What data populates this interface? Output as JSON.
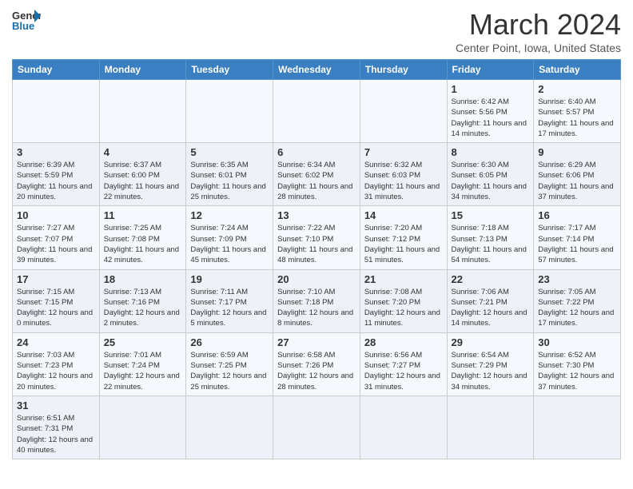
{
  "logo": {
    "line1": "General",
    "line2": "Blue"
  },
  "title": "March 2024",
  "subtitle": "Center Point, Iowa, United States",
  "days_of_week": [
    "Sunday",
    "Monday",
    "Tuesday",
    "Wednesday",
    "Thursday",
    "Friday",
    "Saturday"
  ],
  "weeks": [
    [
      {
        "day": "",
        "info": ""
      },
      {
        "day": "",
        "info": ""
      },
      {
        "day": "",
        "info": ""
      },
      {
        "day": "",
        "info": ""
      },
      {
        "day": "",
        "info": ""
      },
      {
        "day": "1",
        "info": "Sunrise: 6:42 AM\nSunset: 5:56 PM\nDaylight: 11 hours and 14 minutes."
      },
      {
        "day": "2",
        "info": "Sunrise: 6:40 AM\nSunset: 5:57 PM\nDaylight: 11 hours and 17 minutes."
      }
    ],
    [
      {
        "day": "3",
        "info": "Sunrise: 6:39 AM\nSunset: 5:59 PM\nDaylight: 11 hours and 20 minutes."
      },
      {
        "day": "4",
        "info": "Sunrise: 6:37 AM\nSunset: 6:00 PM\nDaylight: 11 hours and 22 minutes."
      },
      {
        "day": "5",
        "info": "Sunrise: 6:35 AM\nSunset: 6:01 PM\nDaylight: 11 hours and 25 minutes."
      },
      {
        "day": "6",
        "info": "Sunrise: 6:34 AM\nSunset: 6:02 PM\nDaylight: 11 hours and 28 minutes."
      },
      {
        "day": "7",
        "info": "Sunrise: 6:32 AM\nSunset: 6:03 PM\nDaylight: 11 hours and 31 minutes."
      },
      {
        "day": "8",
        "info": "Sunrise: 6:30 AM\nSunset: 6:05 PM\nDaylight: 11 hours and 34 minutes."
      },
      {
        "day": "9",
        "info": "Sunrise: 6:29 AM\nSunset: 6:06 PM\nDaylight: 11 hours and 37 minutes."
      }
    ],
    [
      {
        "day": "10",
        "info": "Sunrise: 7:27 AM\nSunset: 7:07 PM\nDaylight: 11 hours and 39 minutes."
      },
      {
        "day": "11",
        "info": "Sunrise: 7:25 AM\nSunset: 7:08 PM\nDaylight: 11 hours and 42 minutes."
      },
      {
        "day": "12",
        "info": "Sunrise: 7:24 AM\nSunset: 7:09 PM\nDaylight: 11 hours and 45 minutes."
      },
      {
        "day": "13",
        "info": "Sunrise: 7:22 AM\nSunset: 7:10 PM\nDaylight: 11 hours and 48 minutes."
      },
      {
        "day": "14",
        "info": "Sunrise: 7:20 AM\nSunset: 7:12 PM\nDaylight: 11 hours and 51 minutes."
      },
      {
        "day": "15",
        "info": "Sunrise: 7:18 AM\nSunset: 7:13 PM\nDaylight: 11 hours and 54 minutes."
      },
      {
        "day": "16",
        "info": "Sunrise: 7:17 AM\nSunset: 7:14 PM\nDaylight: 11 hours and 57 minutes."
      }
    ],
    [
      {
        "day": "17",
        "info": "Sunrise: 7:15 AM\nSunset: 7:15 PM\nDaylight: 12 hours and 0 minutes."
      },
      {
        "day": "18",
        "info": "Sunrise: 7:13 AM\nSunset: 7:16 PM\nDaylight: 12 hours and 2 minutes."
      },
      {
        "day": "19",
        "info": "Sunrise: 7:11 AM\nSunset: 7:17 PM\nDaylight: 12 hours and 5 minutes."
      },
      {
        "day": "20",
        "info": "Sunrise: 7:10 AM\nSunset: 7:18 PM\nDaylight: 12 hours and 8 minutes."
      },
      {
        "day": "21",
        "info": "Sunrise: 7:08 AM\nSunset: 7:20 PM\nDaylight: 12 hours and 11 minutes."
      },
      {
        "day": "22",
        "info": "Sunrise: 7:06 AM\nSunset: 7:21 PM\nDaylight: 12 hours and 14 minutes."
      },
      {
        "day": "23",
        "info": "Sunrise: 7:05 AM\nSunset: 7:22 PM\nDaylight: 12 hours and 17 minutes."
      }
    ],
    [
      {
        "day": "24",
        "info": "Sunrise: 7:03 AM\nSunset: 7:23 PM\nDaylight: 12 hours and 20 minutes."
      },
      {
        "day": "25",
        "info": "Sunrise: 7:01 AM\nSunset: 7:24 PM\nDaylight: 12 hours and 22 minutes."
      },
      {
        "day": "26",
        "info": "Sunrise: 6:59 AM\nSunset: 7:25 PM\nDaylight: 12 hours and 25 minutes."
      },
      {
        "day": "27",
        "info": "Sunrise: 6:58 AM\nSunset: 7:26 PM\nDaylight: 12 hours and 28 minutes."
      },
      {
        "day": "28",
        "info": "Sunrise: 6:56 AM\nSunset: 7:27 PM\nDaylight: 12 hours and 31 minutes."
      },
      {
        "day": "29",
        "info": "Sunrise: 6:54 AM\nSunset: 7:29 PM\nDaylight: 12 hours and 34 minutes."
      },
      {
        "day": "30",
        "info": "Sunrise: 6:52 AM\nSunset: 7:30 PM\nDaylight: 12 hours and 37 minutes."
      }
    ],
    [
      {
        "day": "31",
        "info": "Sunrise: 6:51 AM\nSunset: 7:31 PM\nDaylight: 12 hours and 40 minutes."
      },
      {
        "day": "",
        "info": ""
      },
      {
        "day": "",
        "info": ""
      },
      {
        "day": "",
        "info": ""
      },
      {
        "day": "",
        "info": ""
      },
      {
        "day": "",
        "info": ""
      },
      {
        "day": "",
        "info": ""
      }
    ]
  ]
}
